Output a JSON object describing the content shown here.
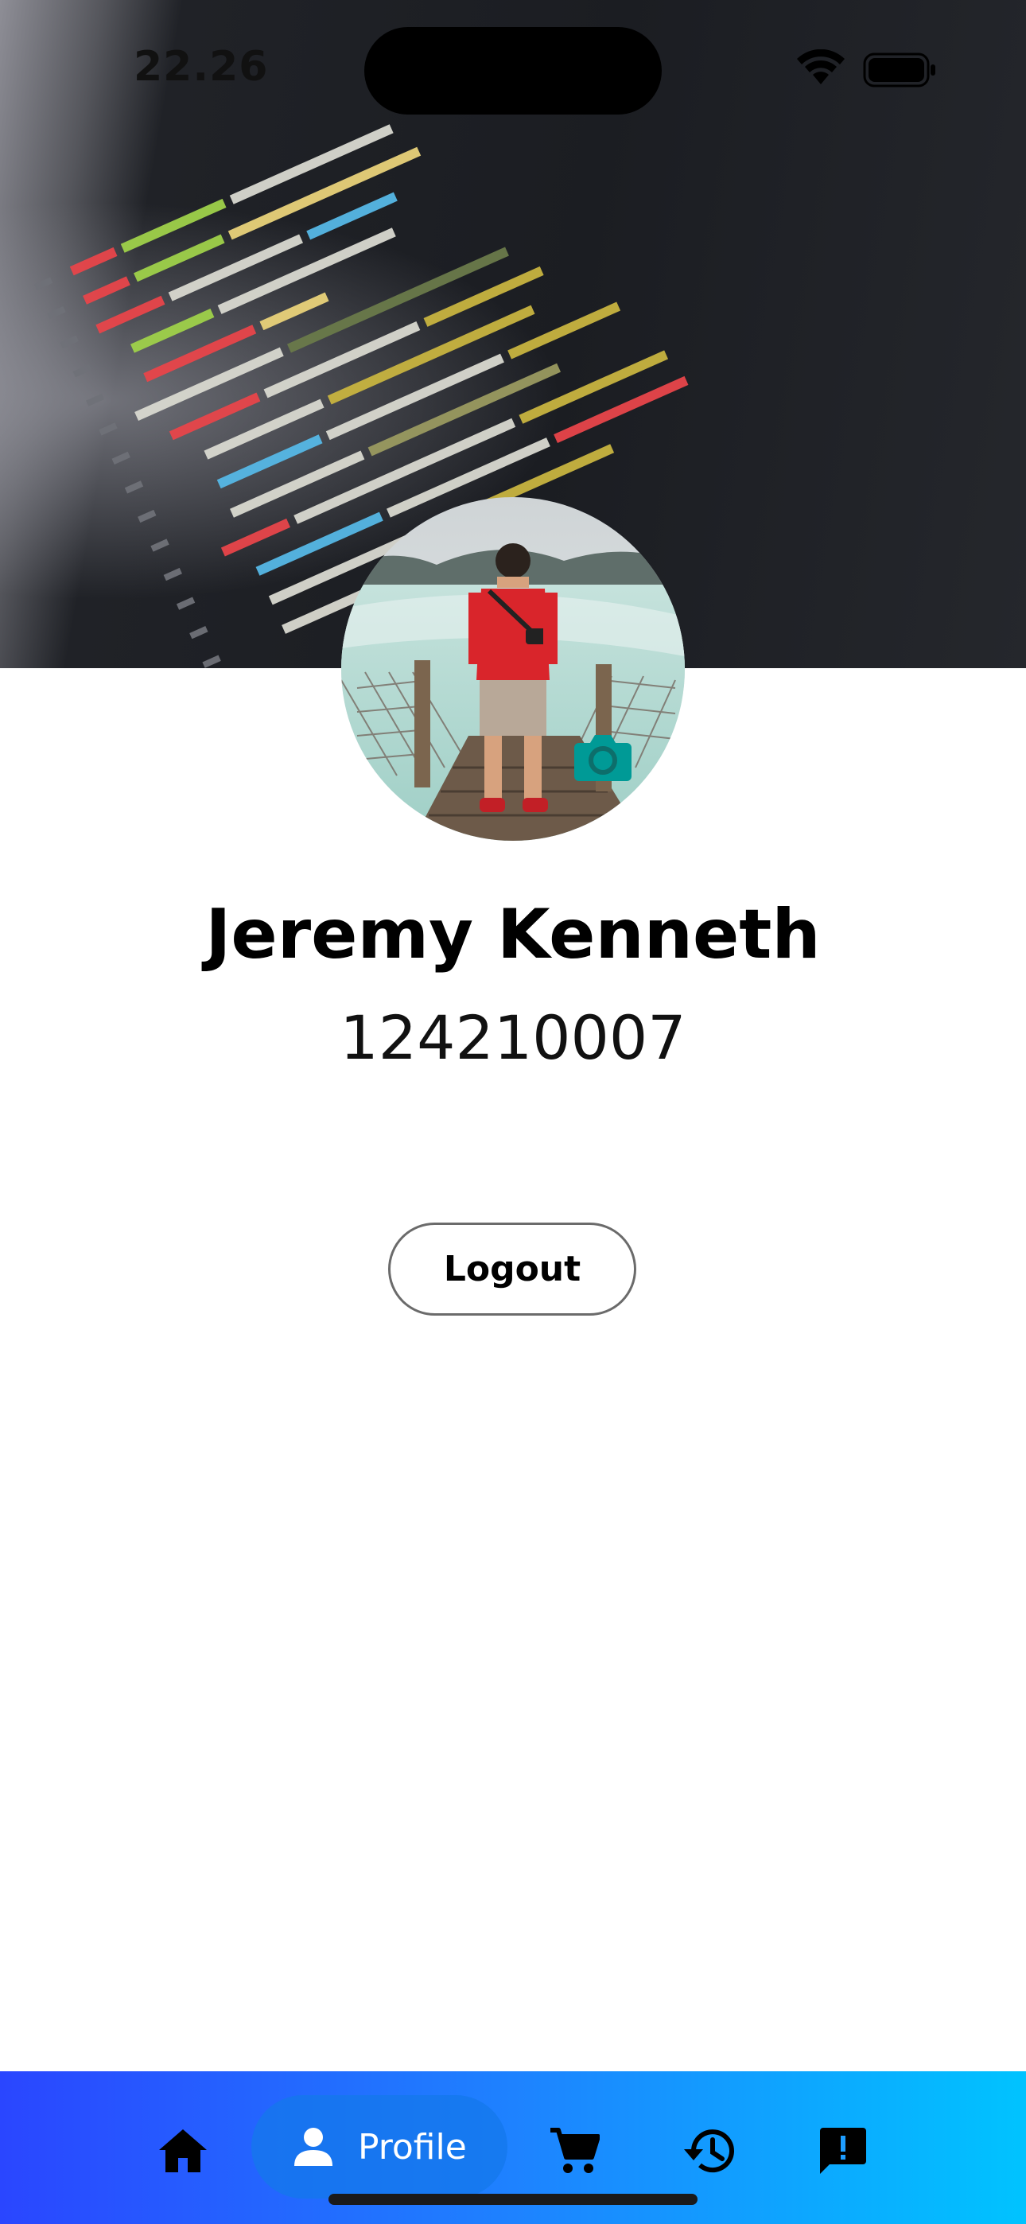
{
  "status_bar": {
    "time": "22.26"
  },
  "profile": {
    "name": "Jeremy Kenneth",
    "id_number": "124210007"
  },
  "actions": {
    "logout_label": "Logout"
  },
  "bottom_nav": {
    "items": [
      {
        "icon": "home-icon",
        "label": ""
      },
      {
        "icon": "person-icon",
        "label": "Profile",
        "active": true
      },
      {
        "icon": "cart-icon",
        "label": ""
      },
      {
        "icon": "history-icon",
        "label": ""
      },
      {
        "icon": "feedback-icon",
        "label": ""
      }
    ]
  },
  "colors": {
    "nav_gradient_start": "#2a46ff",
    "nav_gradient_end": "#00c3ff",
    "camera_accent": "#009a96"
  }
}
